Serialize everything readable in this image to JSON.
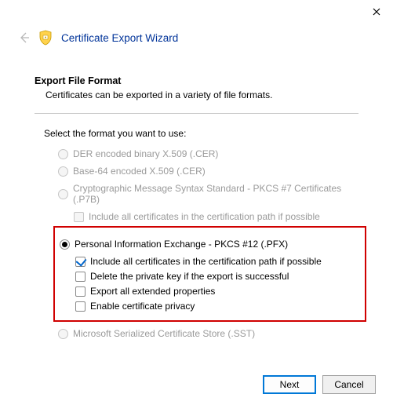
{
  "header": {
    "wizard_title": "Certificate Export Wizard"
  },
  "section": {
    "title": "Export File Format",
    "subtitle": "Certificates can be exported in a variety of file formats."
  },
  "select_label": "Select the format you want to use:",
  "options": {
    "der": {
      "label": "DER encoded binary X.509 (.CER)",
      "enabled": false
    },
    "base64": {
      "label": "Base-64 encoded X.509 (.CER)",
      "enabled": false
    },
    "pkcs7": {
      "label": "Cryptographic Message Syntax Standard - PKCS #7 Certificates (.P7B)",
      "enabled": false,
      "include_chain": "Include all certificates in the certification path if possible"
    },
    "pfx": {
      "label": "Personal Information Exchange - PKCS #12 (.PFX)",
      "selected": true,
      "sub": {
        "include_chain": {
          "label": "Include all certificates in the certification path if possible",
          "checked": true
        },
        "delete_key": {
          "label": "Delete the private key if the export is successful",
          "checked": false
        },
        "export_ext": {
          "label": "Export all extended properties",
          "checked": false
        },
        "cert_privacy": {
          "label": "Enable certificate privacy",
          "checked": false
        }
      }
    },
    "sst": {
      "label": "Microsoft Serialized Certificate Store (.SST)",
      "enabled": false
    }
  },
  "footer": {
    "next": "Next",
    "cancel": "Cancel"
  }
}
